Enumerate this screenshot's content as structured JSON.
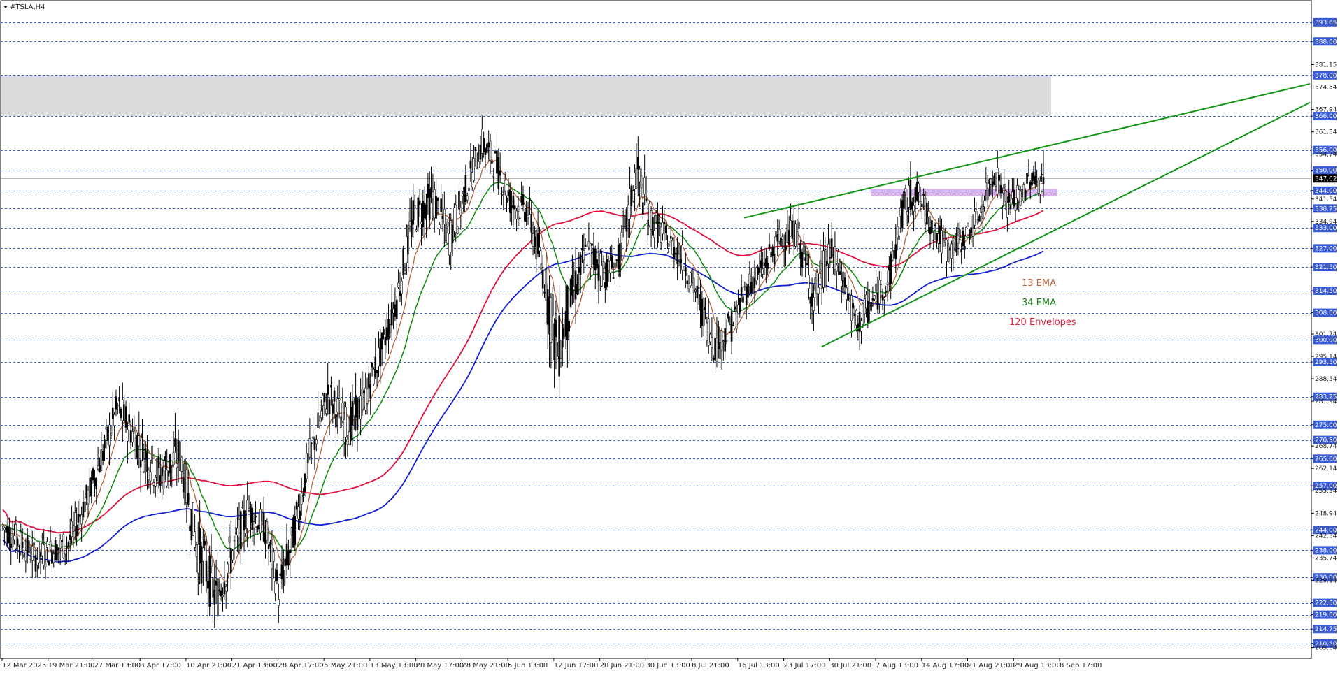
{
  "window": {
    "symbol_title": "#TSLA,H4"
  },
  "legend": {
    "items": [
      {
        "label": "13 EMA",
        "color": "#b5653a"
      },
      {
        "label": "34 EMA",
        "color": "#1a8a1a"
      },
      {
        "label": "120 Envelopes",
        "color": "#e0203c"
      }
    ]
  },
  "colors": {
    "candles": "#000000",
    "ema13": "#b5653a",
    "ema34": "#0d8a0d",
    "env_upper": "#e0103c",
    "env_lower": "#1020d0",
    "trendline": "#139613",
    "level_line": "#3a5bd6",
    "resistance_zone": "#dcdcdc",
    "pivot_zone": "#d8b4e8"
  },
  "chart_data": {
    "type": "candlestick",
    "symbol": "#TSLA",
    "timeframe": "H4",
    "x_labels": [
      "12 Mar 2025",
      "19 Mar 21:00",
      "27 Mar 13:00",
      "3 Apr 17:00",
      "10 Apr 21:00",
      "21 Apr 13:00",
      "28 Apr 17:00",
      "5 May 21:00",
      "13 May 13:00",
      "20 May 17:00",
      "28 May 21:00",
      "5 Jun 13:00",
      "12 Jun 17:00",
      "20 Jun 21:00",
      "30 Jun 13:00",
      "8 Jul 21:00",
      "16 Jul 13:00",
      "23 Jul 17:00",
      "30 Jul 21:00",
      "7 Aug 13:00",
      "14 Aug 17:00",
      "21 Aug 21:00",
      "29 Aug 13:00",
      "8 Sep 17:00"
    ],
    "y_ticks": [
      "393.65",
      "388.00",
      "381.15",
      "378.00",
      "374.54",
      "367.94",
      "366.00",
      "361.34",
      "356.00",
      "354.74",
      "350.00",
      "344.00",
      "341.54",
      "338.75",
      "334.94",
      "333.00",
      "327.00",
      "321.50",
      "314.50",
      "308.00",
      "301.74",
      "300.00",
      "295.14",
      "293.50",
      "288.54",
      "283.25",
      "281.94",
      "275.00",
      "270.50",
      "268.74",
      "265.00",
      "262.14",
      "257.00",
      "255.54",
      "248.94",
      "244.00",
      "242.34",
      "238.00",
      "235.74",
      "230.00",
      "229.14",
      "222.50",
      "219.00",
      "214.75",
      "210.50",
      "209.34"
    ],
    "highlighted_levels": [
      "393.65",
      "388.00",
      "378.00",
      "366.00",
      "356.00",
      "350.00",
      "344.00",
      "338.75",
      "333.00",
      "327.00",
      "321.50",
      "314.50",
      "308.00",
      "300.00",
      "293.50",
      "283.25",
      "275.00",
      "270.50",
      "265.00",
      "257.00",
      "244.00",
      "238.00",
      "230.00",
      "222.50",
      "219.00",
      "214.75",
      "210.50"
    ],
    "y_range": [
      208.0,
      396.5
    ],
    "current_price": "347.62",
    "resistance_zone": [
      366.0,
      378.0
    ],
    "pivot_zone": [
      342.5,
      344.5
    ],
    "indicators": [
      "13 EMA",
      "34 EMA",
      "120 Envelopes"
    ],
    "anchors": [
      [
        0,
        244,
        252,
        235,
        245
      ],
      [
        20,
        230,
        240,
        222,
        236
      ],
      [
        40,
        236,
        245,
        228,
        240
      ],
      [
        55,
        247,
        262,
        244,
        258
      ],
      [
        70,
        268,
        285,
        262,
        280
      ],
      [
        80,
        275,
        290,
        268,
        272
      ],
      [
        95,
        262,
        276,
        248,
        260
      ],
      [
        108,
        260,
        272,
        246,
        266
      ],
      [
        118,
        252,
        265,
        236,
        240
      ],
      [
        130,
        240,
        252,
        218,
        224
      ],
      [
        140,
        226,
        240,
        214,
        238
      ],
      [
        150,
        242,
        255,
        235,
        250
      ],
      [
        160,
        248,
        258,
        240,
        244
      ],
      [
        168,
        240,
        248,
        222,
        226
      ],
      [
        176,
        230,
        246,
        224,
        240
      ],
      [
        186,
        250,
        268,
        246,
        264
      ],
      [
        198,
        272,
        290,
        268,
        284
      ],
      [
        210,
        280,
        292,
        268,
        274
      ],
      [
        220,
        272,
        288,
        266,
        282
      ],
      [
        230,
        284,
        300,
        282,
        296
      ],
      [
        240,
        300,
        316,
        296,
        312
      ],
      [
        250,
        318,
        340,
        314,
        336
      ],
      [
        262,
        336,
        350,
        330,
        342
      ],
      [
        272,
        340,
        352,
        326,
        330
      ],
      [
        282,
        332,
        348,
        328,
        344
      ],
      [
        292,
        348,
        362,
        344,
        358
      ],
      [
        300,
        354,
        368,
        348,
        352
      ],
      [
        310,
        348,
        356,
        336,
        340
      ],
      [
        320,
        340,
        350,
        334,
        338
      ],
      [
        332,
        326,
        340,
        310,
        314
      ],
      [
        338,
        310,
        322,
        272,
        296
      ],
      [
        346,
        300,
        318,
        294,
        312
      ],
      [
        356,
        314,
        334,
        308,
        326
      ],
      [
        368,
        322,
        334,
        312,
        320
      ],
      [
        376,
        318,
        330,
        316,
        324
      ],
      [
        386,
        330,
        358,
        326,
        350
      ],
      [
        394,
        340,
        352,
        330,
        336
      ],
      [
        404,
        332,
        342,
        326,
        330
      ],
      [
        414,
        328,
        336,
        320,
        324
      ],
      [
        424,
        318,
        326,
        308,
        312
      ],
      [
        434,
        304,
        314,
        290,
        298
      ],
      [
        444,
        298,
        308,
        290,
        304
      ],
      [
        454,
        306,
        320,
        302,
        316
      ],
      [
        462,
        312,
        326,
        308,
        320
      ],
      [
        474,
        326,
        338,
        320,
        330
      ],
      [
        484,
        328,
        338,
        322,
        332
      ],
      [
        494,
        326,
        332,
        306,
        312
      ],
      [
        504,
        310,
        330,
        306,
        326
      ],
      [
        512,
        322,
        328,
        312,
        318
      ],
      [
        520,
        314,
        320,
        298,
        304
      ],
      [
        528,
        302,
        314,
        296,
        310
      ],
      [
        540,
        312,
        324,
        308,
        318
      ],
      [
        548,
        318,
        342,
        316,
        338
      ],
      [
        556,
        338,
        350,
        332,
        344
      ],
      [
        566,
        340,
        348,
        330,
        334
      ],
      [
        576,
        334,
        338,
        322,
        326
      ],
      [
        586,
        326,
        334,
        320,
        330
      ],
      [
        596,
        330,
        342,
        328,
        338
      ],
      [
        604,
        338,
        354,
        334,
        350
      ],
      [
        612,
        346,
        352,
        336,
        340
      ],
      [
        620,
        338,
        346,
        330,
        342
      ],
      [
        626,
        342,
        354,
        338,
        348
      ],
      [
        634,
        348,
        356,
        342,
        346
      ]
    ]
  }
}
